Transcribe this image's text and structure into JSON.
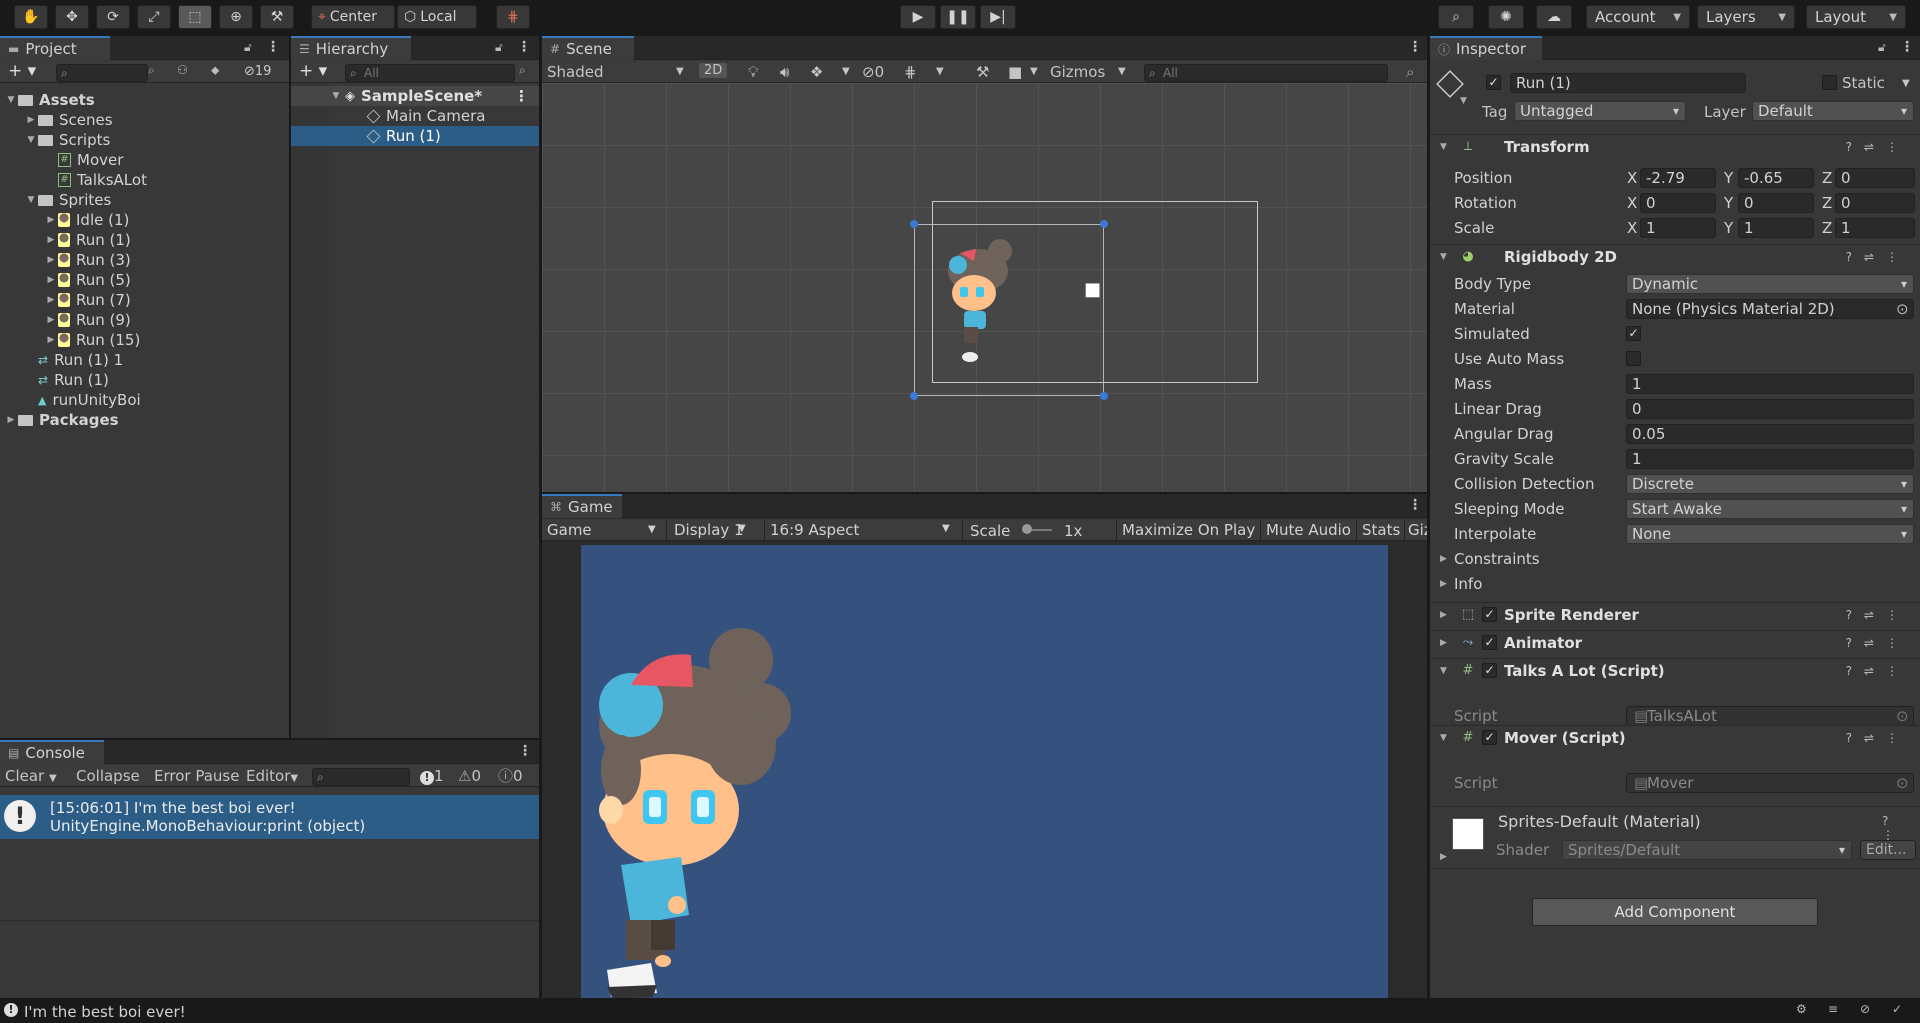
{
  "toolbar": {
    "center_label": "Center",
    "local_label": "Local",
    "account_label": "Account",
    "layers_label": "Layers",
    "layout_label": "Layout"
  },
  "project": {
    "tab_label": "Project",
    "hidden_count": "19",
    "tree": [
      {
        "label": "Assets",
        "kind": "folder-bold",
        "indent": 0
      },
      {
        "label": "Scenes",
        "kind": "folder",
        "indent": 1
      },
      {
        "label": "Scripts",
        "kind": "folder",
        "indent": 1
      },
      {
        "label": "Mover",
        "kind": "script",
        "indent": 2
      },
      {
        "label": "TalksALot",
        "kind": "script",
        "indent": 2
      },
      {
        "label": "Sprites",
        "kind": "folder",
        "indent": 1
      },
      {
        "label": "Idle (1)",
        "kind": "sprite",
        "indent": 2
      },
      {
        "label": "Run (1)",
        "kind": "sprite",
        "indent": 2
      },
      {
        "label": "Run (3)",
        "kind": "sprite",
        "indent": 2
      },
      {
        "label": "Run (5)",
        "kind": "sprite",
        "indent": 2
      },
      {
        "label": "Run (7)",
        "kind": "sprite",
        "indent": 2
      },
      {
        "label": "Run (9)",
        "kind": "sprite",
        "indent": 2
      },
      {
        "label": "Run (15)",
        "kind": "sprite",
        "indent": 2
      },
      {
        "label": "Run (1) 1",
        "kind": "anim",
        "indent": 1
      },
      {
        "label": "Run (1)",
        "kind": "anim",
        "indent": 1
      },
      {
        "label": "runUnityBoi",
        "kind": "clip",
        "indent": 1
      },
      {
        "label": "Packages",
        "kind": "folder-bold",
        "indent": 0
      }
    ]
  },
  "hierarchy": {
    "tab_label": "Hierarchy",
    "search_placeholder": "All",
    "scene_name": "SampleScene*",
    "items": [
      "Main Camera",
      "Run (1)"
    ]
  },
  "scene": {
    "tab_label": "Scene",
    "shading": "Shaded",
    "mode_2d": "2D",
    "hidden_count": "0",
    "gizmos_label": "Gizmos",
    "search_placeholder": "All"
  },
  "game": {
    "tab_label": "Game",
    "view_select": "Game",
    "display_select": "Display 1",
    "aspect_select": "16:9 Aspect",
    "scale_label": "Scale",
    "scale_value": "1x",
    "maximize_label": "Maximize On Play",
    "mute_label": "Mute Audio",
    "stats_label": "Stats",
    "gizmos_partial": "Giz",
    "background_color": "#35527f"
  },
  "console": {
    "tab_label": "Console",
    "clear_label": "Clear",
    "collapse_label": "Collapse",
    "error_pause_label": "Error Pause",
    "editor_label": "Editor",
    "log_count": "1",
    "warn_count": "0",
    "error_count": "0",
    "log_line1": "[15:06:01] I'm the best boi ever!",
    "log_line2": "UnityEngine.MonoBehaviour:print (object)"
  },
  "inspector": {
    "tab_label": "Inspector",
    "object_name": "Run (1)",
    "static_label": "Static",
    "tag_label": "Tag",
    "tag_value": "Untagged",
    "layer_label": "Layer",
    "layer_value": "Default",
    "transform": {
      "title": "Transform",
      "position_label": "Position",
      "pos_x": "-2.79",
      "pos_y": "-0.65",
      "pos_z": "0",
      "rotation_label": "Rotation",
      "rot_x": "0",
      "rot_y": "0",
      "rot_z": "0",
      "scale_label": "Scale",
      "scale_x": "1",
      "scale_y": "1",
      "scale_z": "1"
    },
    "rigidbody": {
      "title": "Rigidbody 2D",
      "body_type_label": "Body Type",
      "body_type": "Dynamic",
      "material_label": "Material",
      "material": "None (Physics Material 2D)",
      "simulated_label": "Simulated",
      "use_auto_mass_label": "Use Auto Mass",
      "mass_label": "Mass",
      "mass": "1",
      "linear_drag_label": "Linear Drag",
      "linear_drag": "0",
      "angular_drag_label": "Angular Drag",
      "angular_drag": "0.05",
      "gravity_scale_label": "Gravity Scale",
      "gravity_scale": "1",
      "collision_detection_label": "Collision Detection",
      "collision_detection": "Discrete",
      "sleeping_mode_label": "Sleeping Mode",
      "sleeping_mode": "Start Awake",
      "interpolate_label": "Interpolate",
      "interpolate": "None",
      "constraints_label": "Constraints",
      "info_label": "Info"
    },
    "sprite_renderer_title": "Sprite Renderer",
    "animator_title": "Animator",
    "talks_title": "Talks A Lot (Script)",
    "talks_script_label": "Script",
    "talks_script_value": "TalksALot",
    "mover_title": "Mover (Script)",
    "mover_script_label": "Script",
    "mover_script_value": "Mover",
    "material_title": "Sprites-Default (Material)",
    "shader_label": "Shader",
    "shader_value": "Sprites/Default",
    "edit_label": "Edit...",
    "add_component_label": "Add Component"
  },
  "status": {
    "message": "I'm the best boi ever!"
  },
  "colors": {
    "accent": "#3a79bb",
    "selection": "#2c5d87"
  }
}
